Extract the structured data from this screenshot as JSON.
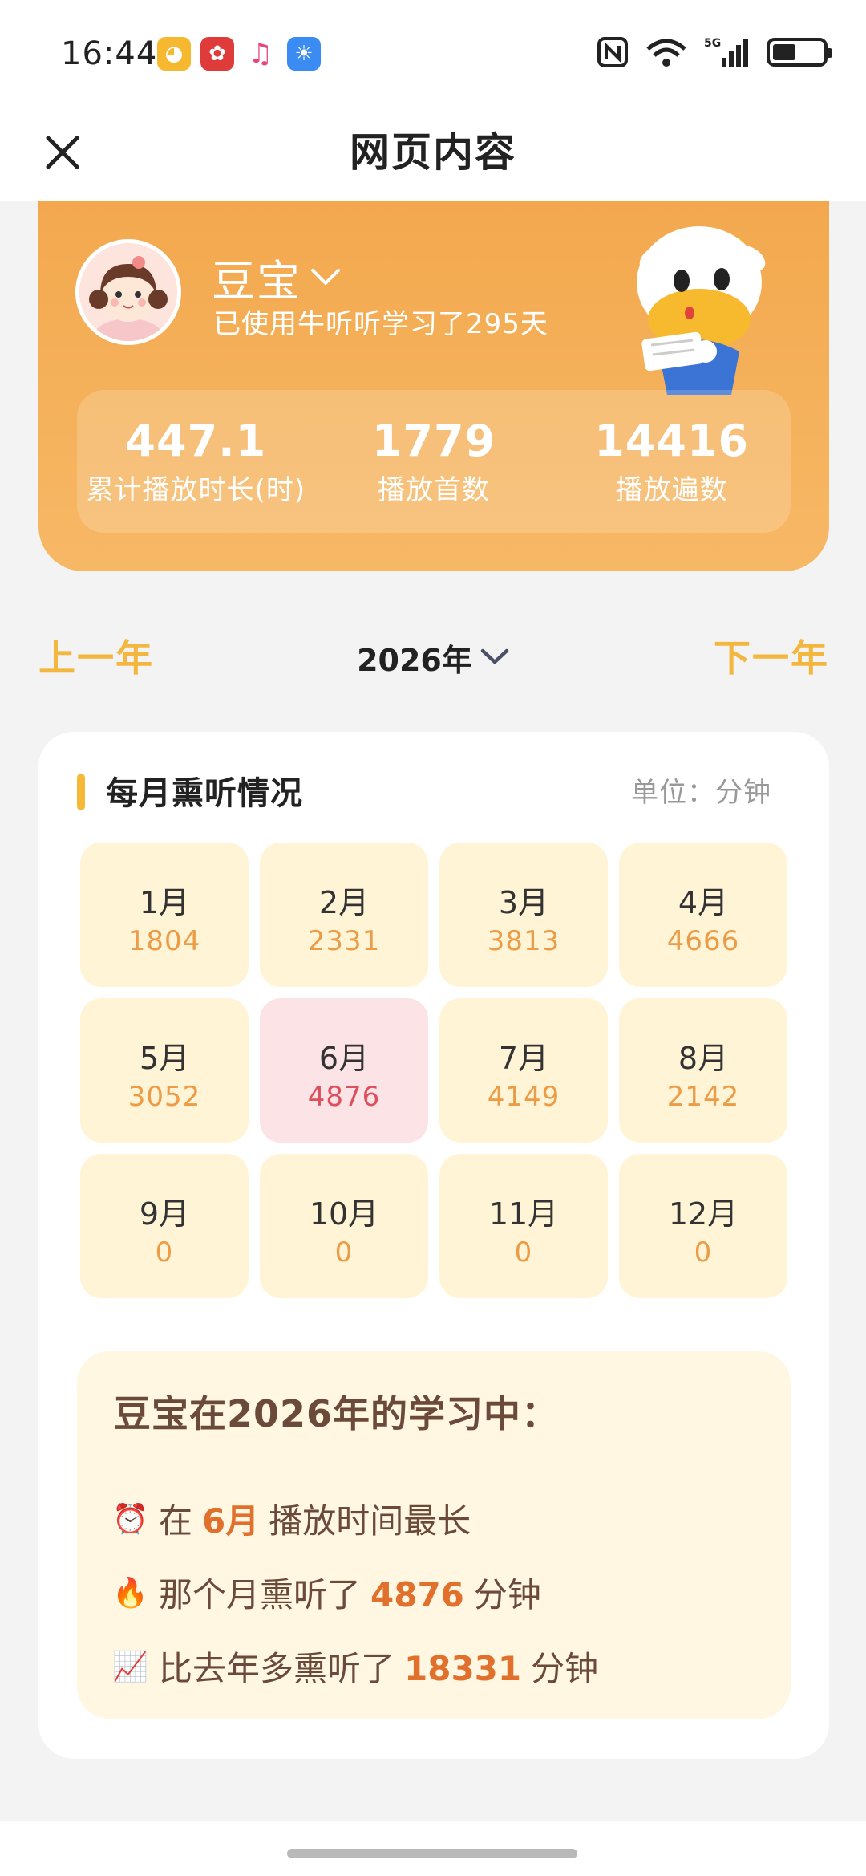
{
  "status_bar": {
    "time": "16:44",
    "network_label": "5G",
    "wifi_label": "6"
  },
  "nav": {
    "title": "网页内容"
  },
  "profile": {
    "name": "豆宝",
    "days_text": "已使用牛听听学习了295天",
    "stats": [
      {
        "value": "447.1",
        "label": "累计播放时长(时)"
      },
      {
        "value": "1779",
        "label": "播放首数"
      },
      {
        "value": "14416",
        "label": "播放遍数"
      }
    ]
  },
  "year_nav": {
    "prev": "上一年",
    "current": "2026年",
    "next": "下一年"
  },
  "monthly": {
    "title": "每月熏听情况",
    "unit": "单位：分钟",
    "months": [
      {
        "name": "1月",
        "value": "1804"
      },
      {
        "name": "2月",
        "value": "2331"
      },
      {
        "name": "3月",
        "value": "3813"
      },
      {
        "name": "4月",
        "value": "4666"
      },
      {
        "name": "5月",
        "value": "3052"
      },
      {
        "name": "6月",
        "value": "4876"
      },
      {
        "name": "7月",
        "value": "4149"
      },
      {
        "name": "8月",
        "value": "2142"
      },
      {
        "name": "9月",
        "value": "0"
      },
      {
        "name": "10月",
        "value": "0"
      },
      {
        "name": "11月",
        "value": "0"
      },
      {
        "name": "12月",
        "value": "0"
      }
    ],
    "highlight_index": 5
  },
  "summary": {
    "title": "豆宝在2026年的学习中：",
    "line1": {
      "emoji": "⏰",
      "prefix": "在",
      "highlight": "6月",
      "suffix": "播放时间最长"
    },
    "line2": {
      "emoji": "🔥",
      "prefix": "那个月熏听了",
      "highlight": "4876",
      "suffix": "分钟"
    },
    "line3": {
      "emoji": "📈",
      "prefix": "比去年多熏听了",
      "highlight": "18331",
      "suffix": "分钟"
    }
  },
  "colors": {
    "accent_orange": "#f3a84e",
    "year_nav_yellow": "#f3b63f",
    "month_bg": "#fff5d6",
    "month_highlight_bg": "#fbe3e6",
    "summary_highlight": "#e0702c"
  }
}
